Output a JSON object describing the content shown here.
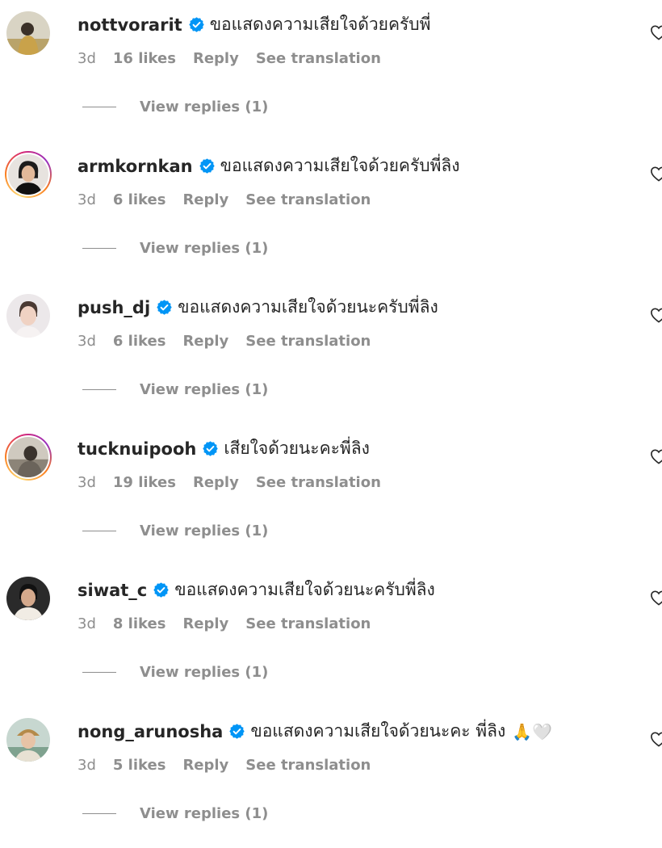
{
  "colors": {
    "text": "#262626",
    "muted": "#8e8e8e",
    "verified": "#0095f6"
  },
  "comments": [
    {
      "username": "nottvorarit",
      "text": "ขอแสดงความเสียใจด้วยครับพี่",
      "time": "3d",
      "likes": "16 likes",
      "reply": "Reply",
      "translate": "See translation",
      "view_replies": "View replies (1)",
      "avatar_icon": "avatar-photo",
      "story_ring": false
    },
    {
      "username": "armkornkan",
      "text": "ขอแสดงความเสียใจด้วยครับพี่ลิง",
      "time": "3d",
      "likes": "6 likes",
      "reply": "Reply",
      "translate": "See translation",
      "view_replies": "View replies (1)",
      "avatar_icon": "avatar-photo",
      "story_ring": true
    },
    {
      "username": "push_dj",
      "text": "ขอแสดงความเสียใจด้วยนะครับพี่ลิง",
      "time": "3d",
      "likes": "6 likes",
      "reply": "Reply",
      "translate": "See translation",
      "view_replies": "View replies (1)",
      "avatar_icon": "avatar-photo",
      "story_ring": false
    },
    {
      "username": "tucknuipooh",
      "text": "เสียใจด้วยนะคะพี่ลิง",
      "time": "3d",
      "likes": "19 likes",
      "reply": "Reply",
      "translate": "See translation",
      "view_replies": "View replies (1)",
      "avatar_icon": "avatar-photo",
      "story_ring": true
    },
    {
      "username": "siwat_c",
      "text": "ขอแสดงความเสียใจด้วยนะครับพี่ลิง",
      "time": "3d",
      "likes": "8 likes",
      "reply": "Reply",
      "translate": "See translation",
      "view_replies": "View replies (1)",
      "avatar_icon": "avatar-photo",
      "story_ring": false
    },
    {
      "username": "nong_arunosha",
      "text": "ขอแสดงความเสียใจด้วยนะคะ พี่ลิง",
      "emoji": "🙏🤍",
      "time": "3d",
      "likes": "5 likes",
      "reply": "Reply",
      "translate": "See translation",
      "view_replies": "View replies (1)",
      "avatar_icon": "avatar-photo",
      "story_ring": false
    }
  ]
}
